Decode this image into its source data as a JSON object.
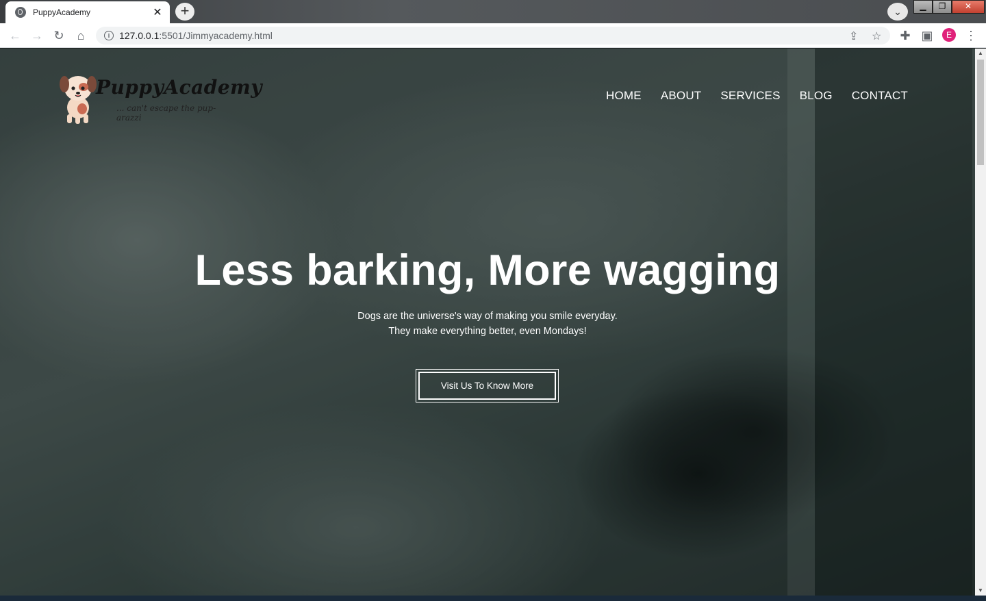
{
  "browser": {
    "tab_title": "PuppyAcademy",
    "tab_close": "✕",
    "new_tab": "+",
    "url_host": "127.0.0.1",
    "url_path": ":5501/Jimmyacademy.html",
    "avatar_letter": "E",
    "info_icon": "i"
  },
  "site": {
    "logo_text": "PuppyAcademy",
    "logo_tagline": "... can't escape the pup-arazzi",
    "nav": [
      "HOME",
      "ABOUT",
      "SERVICES",
      "BLOG",
      "CONTACT"
    ],
    "hero_title": "Less barking, More wagging",
    "hero_line1": "Dogs are the universe's way of making you smile everyday.",
    "hero_line2": "They make everything better, even Mondays!",
    "cta_label": "Visit Us To Know More"
  },
  "colors": {
    "overlay": "#3f4a48",
    "text": "#ffffff",
    "avatar": "#e0217a"
  }
}
